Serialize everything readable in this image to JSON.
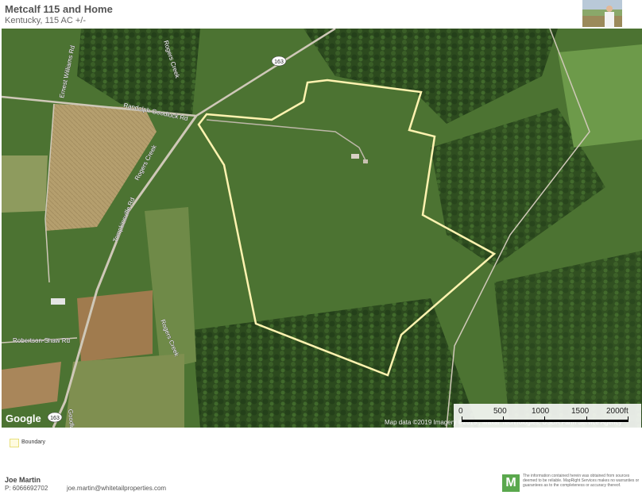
{
  "header": {
    "title": "Metcalf 115 and Home",
    "subtitle": "Kentucky, 115 AC +/-"
  },
  "map": {
    "road_labels": {
      "rogers_creek_top": "Rogers Creek",
      "ernest_williams": "Ernest Williams Rd",
      "randolph_goodluck": "Randolph Goodluck Rd",
      "rogers_creek_mid": "Rogers Creek",
      "tompkinsville": "Tompkinsville Rd",
      "robertson_shaw": "Robertson-Shaw Rd",
      "rogers_creek_bottom": "Rogers Creek",
      "route_163_top": "163",
      "route_163_bottom": "163",
      "goodluck_partial": "Goodlu"
    },
    "google_logo": "Google",
    "attribution": "Map data ©2019  Imagery ©2019 , Maxar Technologies, USDA Farm Service Agency",
    "boundary_color": "#fff3b0"
  },
  "scale": {
    "labels": [
      "0",
      "500",
      "1000",
      "1500",
      "2000ft"
    ]
  },
  "legend": {
    "boundary_label": "Boundary"
  },
  "contact": {
    "name": "Joe Martin",
    "phone": "P: 6066692702",
    "email": "joe.martin@whitetailproperties.com"
  },
  "footer": {
    "logo_letter": "M",
    "disclaimer": "The information contained herein was obtained from sources deemed to be reliable. MapRight Services makes no warranties or guarantees as to the completeness or accuracy thereof."
  }
}
